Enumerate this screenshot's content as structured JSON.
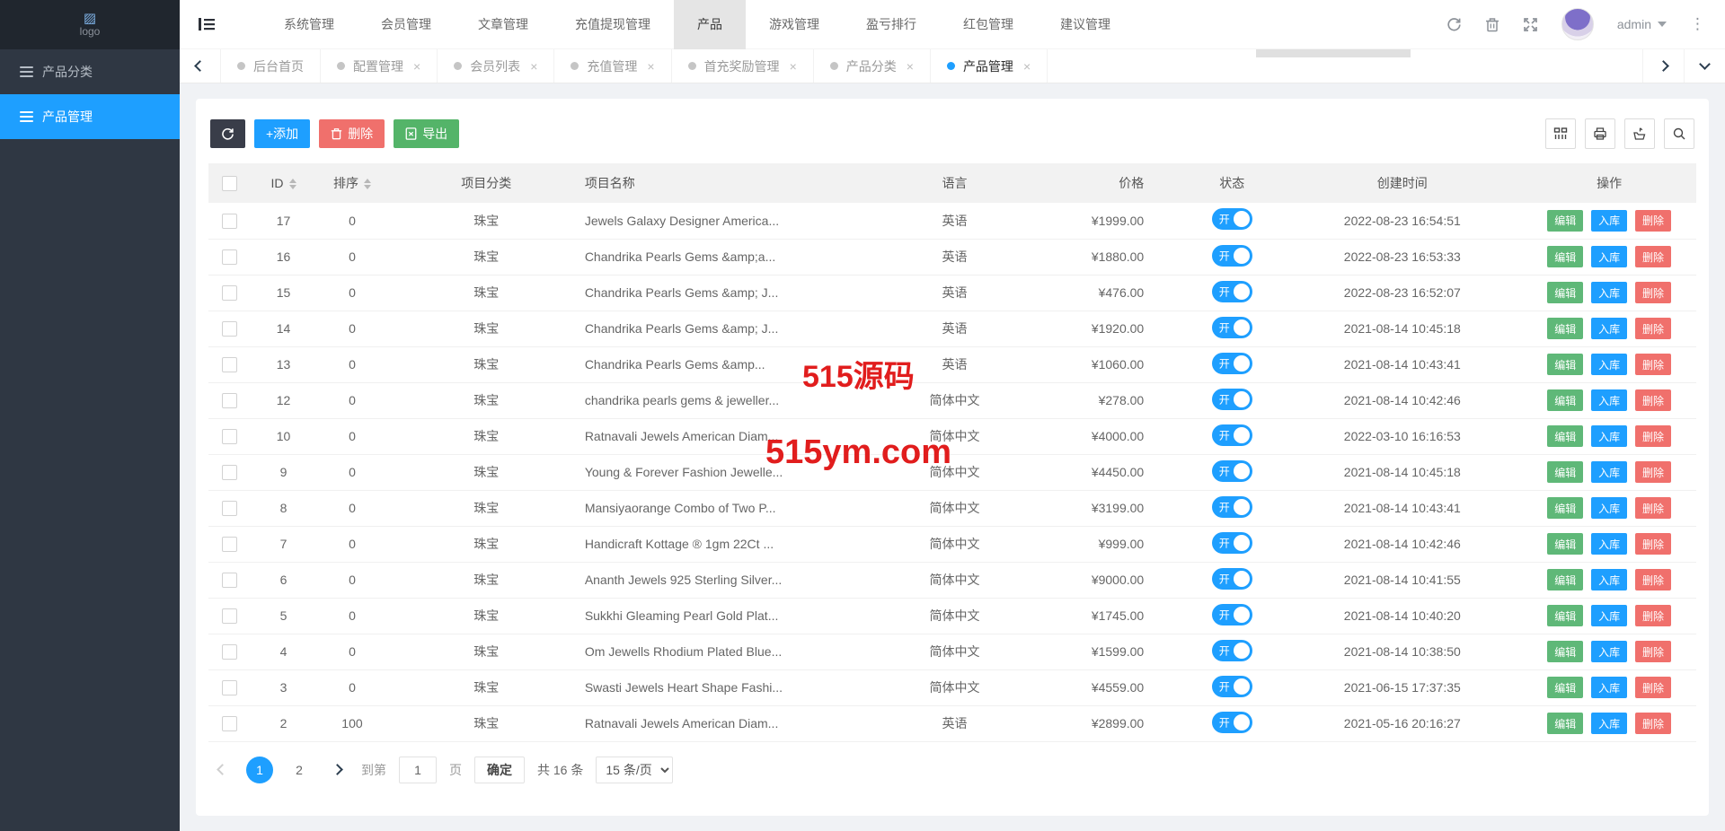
{
  "sidebar": {
    "logo_text": "logo",
    "items": [
      {
        "label": "产品分类",
        "active": false
      },
      {
        "label": "产品管理",
        "active": true
      }
    ]
  },
  "navbar": {
    "menus": [
      {
        "label": "系统管理",
        "active": false
      },
      {
        "label": "会员管理",
        "active": false
      },
      {
        "label": "文章管理",
        "active": false
      },
      {
        "label": "充值提现管理",
        "active": false
      },
      {
        "label": "产品",
        "active": true
      },
      {
        "label": "游戏管理",
        "active": false
      },
      {
        "label": "盈亏排行",
        "active": false
      },
      {
        "label": "红包管理",
        "active": false
      },
      {
        "label": "建议管理",
        "active": false
      }
    ],
    "username": "admin"
  },
  "tabbar": {
    "tabs": [
      {
        "label": "后台首页",
        "closable": false,
        "active": false
      },
      {
        "label": "配置管理",
        "closable": true,
        "active": false
      },
      {
        "label": "会员列表",
        "closable": true,
        "active": false
      },
      {
        "label": "充值管理",
        "closable": true,
        "active": false
      },
      {
        "label": "首充奖励管理",
        "closable": true,
        "active": false
      },
      {
        "label": "产品分类",
        "closable": true,
        "active": false
      },
      {
        "label": "产品管理",
        "closable": true,
        "active": true
      }
    ],
    "close_glyph": "×"
  },
  "toolbar": {
    "add_label": "+添加",
    "delete_label": "删除",
    "export_label": "导出"
  },
  "table": {
    "headers": {
      "id": "ID",
      "sort": "排序",
      "category": "项目分类",
      "name": "项目名称",
      "language": "语言",
      "price": "价格",
      "status": "状态",
      "created": "创建时间",
      "ops": "操作"
    },
    "toggle_on_label": "开",
    "actions": {
      "edit": "编辑",
      "stock_in": "入库",
      "delete": "删除"
    },
    "rows": [
      {
        "id": "17",
        "sort": "0",
        "category": "珠宝",
        "name": "Jewels Galaxy Designer America...",
        "language": "英语",
        "price": "¥1999.00",
        "created_at": "2022-08-23 16:54:51"
      },
      {
        "id": "16",
        "sort": "0",
        "category": "珠宝",
        "name": "Chandrika Pearls Gems &amp;a...",
        "language": "英语",
        "price": "¥1880.00",
        "created_at": "2022-08-23 16:53:33"
      },
      {
        "id": "15",
        "sort": "0",
        "category": "珠宝",
        "name": "Chandrika Pearls Gems &amp; J...",
        "language": "英语",
        "price": "¥476.00",
        "created_at": "2022-08-23 16:52:07"
      },
      {
        "id": "14",
        "sort": "0",
        "category": "珠宝",
        "name": "Chandrika Pearls Gems &amp; J...",
        "language": "英语",
        "price": "¥1920.00",
        "created_at": "2021-08-14 10:45:18"
      },
      {
        "id": "13",
        "sort": "0",
        "category": "珠宝",
        "name": "Chandrika Pearls Gems &amp...",
        "language": "英语",
        "price": "¥1060.00",
        "created_at": "2021-08-14 10:43:41"
      },
      {
        "id": "12",
        "sort": "0",
        "category": "珠宝",
        "name": "chandrika pearls gems & jeweller...",
        "language": "简体中文",
        "price": "¥278.00",
        "created_at": "2021-08-14 10:42:46"
      },
      {
        "id": "10",
        "sort": "0",
        "category": "珠宝",
        "name": "Ratnavali Jewels American Diam...",
        "language": "简体中文",
        "price": "¥4000.00",
        "created_at": "2022-03-10 16:16:53"
      },
      {
        "id": "9",
        "sort": "0",
        "category": "珠宝",
        "name": "Young & Forever Fashion Jewelle...",
        "language": "简体中文",
        "price": "¥4450.00",
        "created_at": "2021-08-14 10:45:18"
      },
      {
        "id": "8",
        "sort": "0",
        "category": "珠宝",
        "name": "Mansiyaorange Combo of Two P...",
        "language": "简体中文",
        "price": "¥3199.00",
        "created_at": "2021-08-14 10:43:41"
      },
      {
        "id": "7",
        "sort": "0",
        "category": "珠宝",
        "name": "Handicraft Kottage ® 1gm 22Ct ...",
        "language": "简体中文",
        "price": "¥999.00",
        "created_at": "2021-08-14 10:42:46"
      },
      {
        "id": "6",
        "sort": "0",
        "category": "珠宝",
        "name": "Ananth Jewels 925 Sterling Silver...",
        "language": "简体中文",
        "price": "¥9000.00",
        "created_at": "2021-08-14 10:41:55"
      },
      {
        "id": "5",
        "sort": "0",
        "category": "珠宝",
        "name": "Sukkhi Gleaming Pearl Gold Plat...",
        "language": "简体中文",
        "price": "¥1745.00",
        "created_at": "2021-08-14 10:40:20"
      },
      {
        "id": "4",
        "sort": "0",
        "category": "珠宝",
        "name": "Om Jewells Rhodium Plated Blue...",
        "language": "简体中文",
        "price": "¥1599.00",
        "created_at": "2021-08-14 10:38:50"
      },
      {
        "id": "3",
        "sort": "0",
        "category": "珠宝",
        "name": "Swasti Jewels Heart Shape Fashi...",
        "language": "简体中文",
        "price": "¥4559.00",
        "created_at": "2021-06-15 17:37:35"
      },
      {
        "id": "2",
        "sort": "100",
        "category": "珠宝",
        "name": "Ratnavali Jewels American Diam...",
        "language": "英语",
        "price": "¥2899.00",
        "created_at": "2021-05-16 20:16:27"
      }
    ]
  },
  "pagination": {
    "pages": [
      {
        "num": "1",
        "current": true
      },
      {
        "num": "2",
        "current": false
      }
    ],
    "goto_label": "到第",
    "goto_value": "1",
    "page_label": "页",
    "confirm_label": "确定",
    "total_label": "共 16 条",
    "per_page_label": "15 条/页"
  },
  "watermark": {
    "line1": "515源码",
    "line2": "515ym.com"
  },
  "colors": {
    "accent": "#1e9fff",
    "success": "#5fb878",
    "danger": "#f0706c",
    "dark": "#393d49"
  }
}
